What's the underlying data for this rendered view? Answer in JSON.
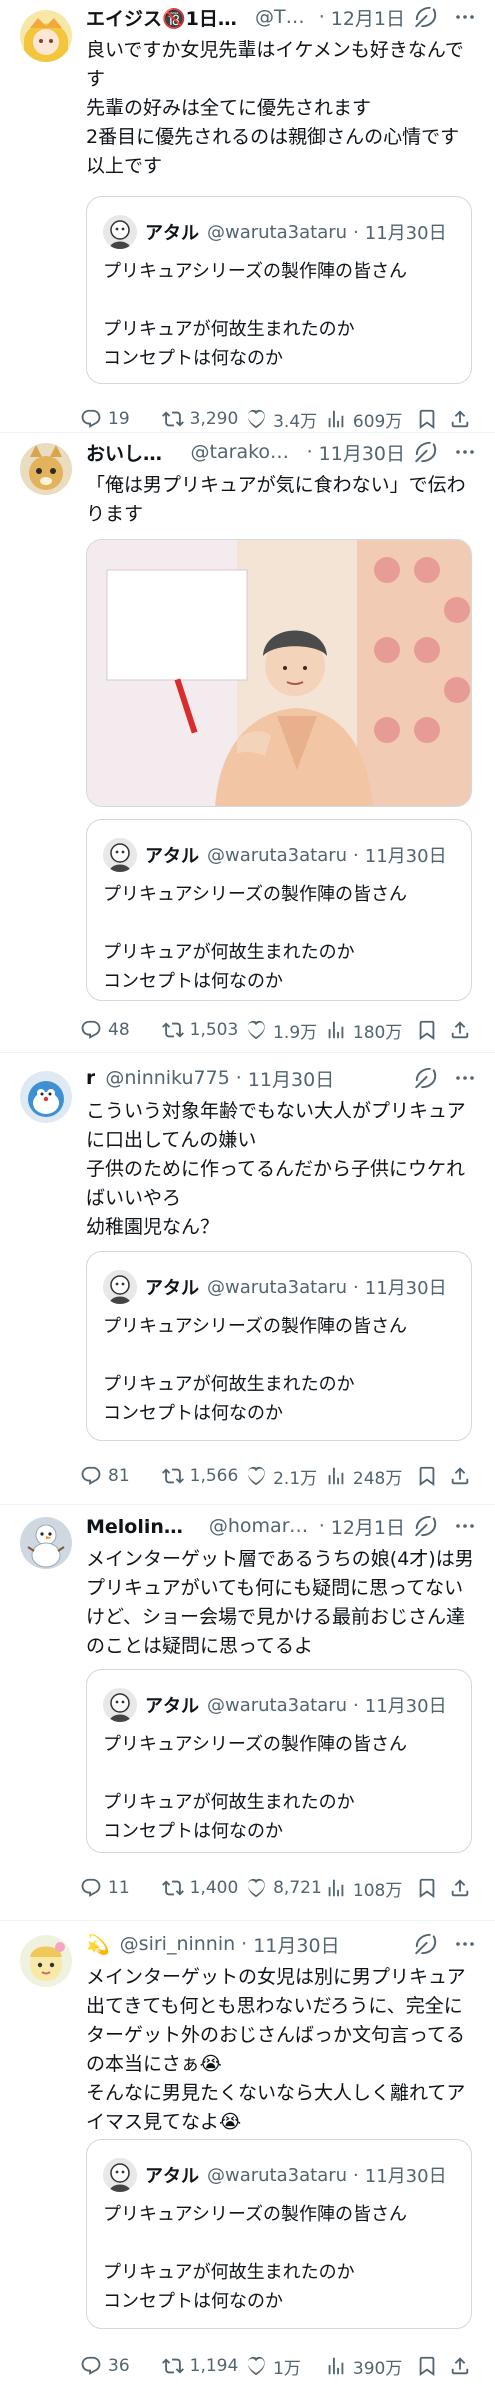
{
  "tweets": [
    {
      "name": "エイジス🔞1日目…",
      "handle": "@Th…",
      "date": "12月1日",
      "text": "良いですか女児先輩はイケメンも好きなんです\n先輩の好みは全てに優先されます\n2番目に優先されるのは親御さんの心情です以上です",
      "quote": {
        "name": "アタル",
        "handle": "@waruta3ataru",
        "date": "11月30日",
        "text": "プリキュアシリーズの製作陣の皆さん\n\nプリキュアが何故生まれたのか\nコンセプトは何なのか"
      },
      "replies": "19",
      "retweets": "3,290",
      "likes": "3.4万",
      "views": "609万"
    },
    {
      "name": "おいしい…",
      "handle": "@tarako1…",
      "date": "11月30日",
      "text": "「俺は男プリキュアが気に食わない」で伝わります",
      "quote": {
        "name": "アタル",
        "handle": "@waruta3ataru",
        "date": "11月30日",
        "text": "プリキュアシリーズの製作陣の皆さん\n\nプリキュアが何故生まれたのか\nコンセプトは何なのか"
      },
      "replies": "48",
      "retweets": "1,503",
      "likes": "1.9万",
      "views": "180万"
    },
    {
      "name": "r",
      "handle": "@ninniku775",
      "date": "11月30日",
      "text": "こういう対象年齢でもない大人がプリキュアに口出してんの嫌い\n子供のために作ってるんだから子供にウケればいいやろ\n幼稚園児なん？",
      "quote": {
        "name": "アタル",
        "handle": "@waruta3ataru",
        "date": "11月30日",
        "text": "プリキュアシリーズの製作陣の皆さん\n\nプリキュアが何故生まれたのか\nコンセプトは何なのか"
      },
      "replies": "81",
      "retweets": "1,566",
      "likes": "2.1万",
      "views": "248万"
    },
    {
      "name": "Melolin❄️…",
      "handle": "@homare…",
      "date": "12月1日",
      "text": "メインターゲット層であるうちの娘(4才)は男プリキュアがいても何にも疑問に思ってないけど、ショー会場で見かける最前おじさん達のことは疑問に思ってるよ",
      "quote": {
        "name": "アタル",
        "handle": "@waruta3ataru",
        "date": "11月30日",
        "text": "プリキュアシリーズの製作陣の皆さん\n\nプリキュアが何故生まれたのか\nコンセプトは何なのか"
      },
      "replies": "11",
      "retweets": "1,400",
      "likes": "8,721",
      "views": "108万"
    },
    {
      "name": "💫",
      "handle": "@siri_ninnin",
      "date": "11月30日",
      "text": "メインターゲットの女児は別に男プリキュア出てきても何とも思わないだろうに、完全にターゲット外のおじさんばっか文句言ってるの本当にさぁ😭\nそんなに男見たくないなら大人しく離れてアイマス見てなよ😭",
      "quote": {
        "name": "アタル",
        "handle": "@waruta3ataru",
        "date": "11月30日",
        "text": "プリキュアシリーズの製作陣の皆さん\n\nプリキュアが何故生まれたのか\nコンセプトは何なのか"
      },
      "replies": "36",
      "retweets": "1,194",
      "likes": "1万",
      "views": "390万"
    }
  ],
  "colors": {
    "text": "#0f1419",
    "secondary": "#536471",
    "border": "#cfd9de"
  }
}
